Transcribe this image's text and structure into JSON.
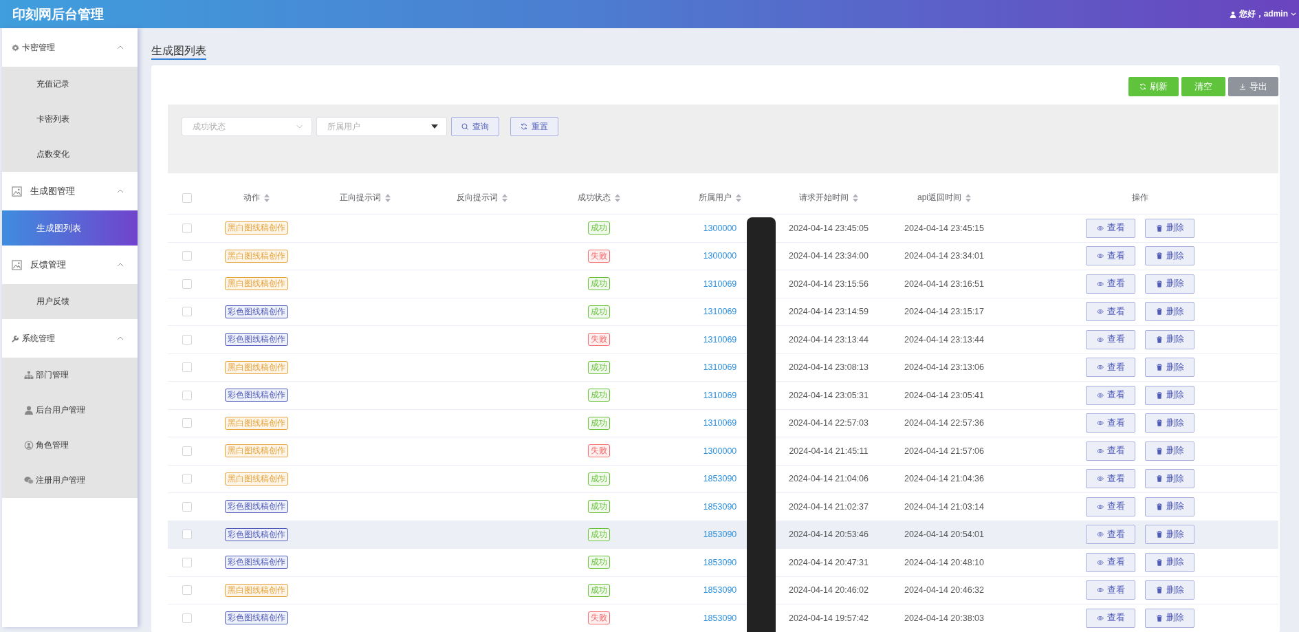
{
  "header": {
    "title": "印刻网后台管理",
    "greeting": "您好，admin"
  },
  "sidebar": {
    "groups": [
      {
        "label": "卡密管理",
        "expanded": true,
        "children": [
          {
            "label": "充值记录",
            "selected": false
          },
          {
            "label": "卡密列表",
            "selected": false
          },
          {
            "label": "点数变化",
            "selected": false
          }
        ]
      },
      {
        "label": "生成图管理",
        "expanded": true,
        "children": [
          {
            "label": "生成图列表",
            "selected": true
          }
        ]
      },
      {
        "label": "反馈管理",
        "expanded": true,
        "children": [
          {
            "label": "用户反馈",
            "selected": false
          }
        ]
      },
      {
        "label": "系统管理",
        "expanded": true,
        "children": [
          {
            "label": "部门管理",
            "selected": false
          },
          {
            "label": "后台用户管理",
            "selected": false
          },
          {
            "label": "角色管理",
            "selected": false
          },
          {
            "label": "注册用户管理",
            "selected": false
          }
        ]
      }
    ]
  },
  "page_tab": {
    "label": "生成图列表",
    "selected": true
  },
  "toolbar": [
    {
      "label": "刷新",
      "kind": "refresh"
    },
    {
      "label": "清空",
      "kind": "plain"
    },
    {
      "label": "导出",
      "kind": "export"
    }
  ],
  "filters": [
    {
      "placeholder": "成功状态",
      "kind": "select"
    },
    {
      "placeholder": "所属用户",
      "kind": "dropdown"
    }
  ],
  "filter_buttons": [
    {
      "label": "查询",
      "kind": "search"
    },
    {
      "label": "重置",
      "kind": "reset"
    }
  ],
  "table": {
    "select_all": {
      "checked": false
    },
    "columns": [
      {
        "label": "动作",
        "sortable": true
      },
      {
        "label": "正向提示词",
        "sortable": true
      },
      {
        "label": "反向提示词",
        "sortable": true
      },
      {
        "label": "成功状态",
        "sortable": true
      },
      {
        "label": "所属用户",
        "sortable": true
      },
      {
        "label": "请求开始时间",
        "sortable": true
      },
      {
        "label": "api返回时间",
        "sortable": true
      },
      {
        "label": "操作",
        "sortable": false
      }
    ],
    "rows": [
      {
        "checked": false,
        "highlighted": false,
        "action": {
          "label": "黑白图线稿创作",
          "kind": "mono"
        },
        "status": "成功",
        "status_ok": true,
        "user": "1300000",
        "start": "2024-04-14 23:45:05",
        "end": "2024-04-14 23:45:15",
        "view": "查看",
        "delete": "删除"
      },
      {
        "checked": false,
        "highlighted": false,
        "action": {
          "label": "黑白图线稿创作",
          "kind": "mono"
        },
        "status": "失败",
        "status_ok": false,
        "user": "1300000",
        "start": "2024-04-14 23:34:00",
        "end": "2024-04-14 23:34:01",
        "view": "查看",
        "delete": "删除"
      },
      {
        "checked": false,
        "highlighted": false,
        "action": {
          "label": "黑白图线稿创作",
          "kind": "mono"
        },
        "status": "成功",
        "status_ok": true,
        "user": "1310069",
        "start": "2024-04-14 23:15:56",
        "end": "2024-04-14 23:16:51",
        "view": "查看",
        "delete": "删除"
      },
      {
        "checked": false,
        "highlighted": false,
        "action": {
          "label": "彩色图线稿创作",
          "kind": "colour"
        },
        "status": "成功",
        "status_ok": true,
        "user": "1310069",
        "start": "2024-04-14 23:14:59",
        "end": "2024-04-14 23:15:17",
        "view": "查看",
        "delete": "删除"
      },
      {
        "checked": false,
        "highlighted": false,
        "action": {
          "label": "彩色图线稿创作",
          "kind": "colour"
        },
        "status": "失败",
        "status_ok": false,
        "user": "1310069",
        "start": "2024-04-14 23:13:44",
        "end": "2024-04-14 23:13:44",
        "view": "查看",
        "delete": "删除"
      },
      {
        "checked": false,
        "highlighted": false,
        "action": {
          "label": "黑白图线稿创作",
          "kind": "mono"
        },
        "status": "成功",
        "status_ok": true,
        "user": "1310069",
        "start": "2024-04-14 23:08:13",
        "end": "2024-04-14 23:13:06",
        "view": "查看",
        "delete": "删除"
      },
      {
        "checked": false,
        "highlighted": false,
        "action": {
          "label": "彩色图线稿创作",
          "kind": "colour"
        },
        "status": "成功",
        "status_ok": true,
        "user": "1310069",
        "start": "2024-04-14 23:05:31",
        "end": "2024-04-14 23:05:41",
        "view": "查看",
        "delete": "删除"
      },
      {
        "checked": false,
        "highlighted": false,
        "action": {
          "label": "黑白图线稿创作",
          "kind": "mono"
        },
        "status": "成功",
        "status_ok": true,
        "user": "1310069",
        "start": "2024-04-14 22:57:03",
        "end": "2024-04-14 22:57:36",
        "view": "查看",
        "delete": "删除"
      },
      {
        "checked": false,
        "highlighted": false,
        "action": {
          "label": "黑白图线稿创作",
          "kind": "mono"
        },
        "status": "失败",
        "status_ok": false,
        "user": "1300000",
        "start": "2024-04-14 21:45:11",
        "end": "2024-04-14 21:57:06",
        "view": "查看",
        "delete": "删除"
      },
      {
        "checked": false,
        "highlighted": false,
        "action": {
          "label": "黑白图线稿创作",
          "kind": "mono"
        },
        "status": "成功",
        "status_ok": true,
        "user": "1853090",
        "start": "2024-04-14 21:04:06",
        "end": "2024-04-14 21:04:36",
        "view": "查看",
        "delete": "删除"
      },
      {
        "checked": false,
        "highlighted": false,
        "action": {
          "label": "彩色图线稿创作",
          "kind": "colour"
        },
        "status": "成功",
        "status_ok": true,
        "user": "1853090",
        "start": "2024-04-14 21:02:37",
        "end": "2024-04-14 21:03:14",
        "view": "查看",
        "delete": "删除"
      },
      {
        "checked": false,
        "highlighted": true,
        "action": {
          "label": "彩色图线稿创作",
          "kind": "colour"
        },
        "status": "成功",
        "status_ok": true,
        "user": "1853090",
        "start": "2024-04-14 20:53:46",
        "end": "2024-04-14 20:54:01",
        "view": "查看",
        "delete": "删除"
      },
      {
        "checked": false,
        "highlighted": false,
        "action": {
          "label": "彩色图线稿创作",
          "kind": "colour"
        },
        "status": "成功",
        "status_ok": true,
        "user": "1853090",
        "start": "2024-04-14 20:47:31",
        "end": "2024-04-14 20:48:10",
        "view": "查看",
        "delete": "删除"
      },
      {
        "checked": false,
        "highlighted": false,
        "action": {
          "label": "黑白图线稿创作",
          "kind": "mono"
        },
        "status": "成功",
        "status_ok": true,
        "user": "1853090",
        "start": "2024-04-14 20:46:02",
        "end": "2024-04-14 20:46:32",
        "view": "查看",
        "delete": "删除"
      },
      {
        "checked": false,
        "highlighted": false,
        "action": {
          "label": "彩色图线稿创作",
          "kind": "colour"
        },
        "status": "失败",
        "status_ok": false,
        "user": "1853090",
        "start": "2024-04-14 19:57:42",
        "end": "2024-04-14 20:38:03",
        "view": "查看",
        "delete": "删除"
      }
    ]
  }
}
